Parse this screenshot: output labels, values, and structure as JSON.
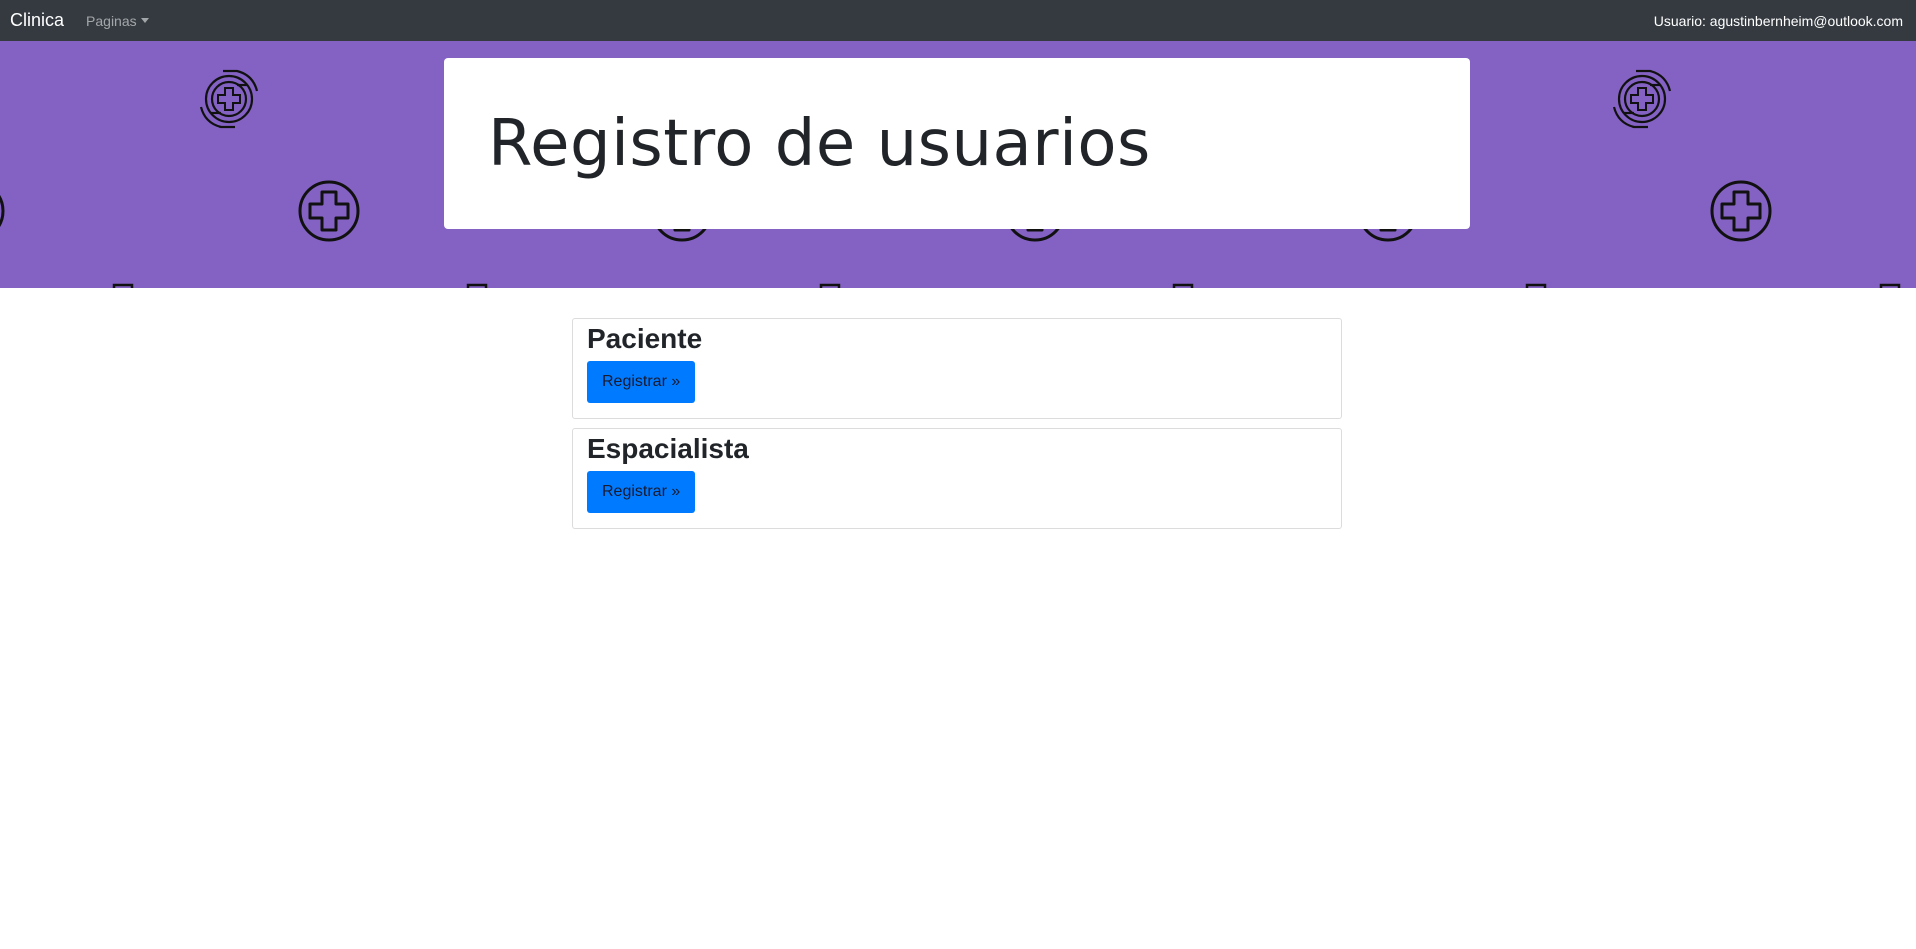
{
  "navbar": {
    "brand": "Clinica",
    "dropdown_label": "Paginas",
    "user_text": "Usuario: agustinbernheim@outlook.com"
  },
  "hero": {
    "title": "Registro de usuarios"
  },
  "cards": [
    {
      "title": "Paciente",
      "button_label": "Registrar »"
    },
    {
      "title": "Espacialista",
      "button_label": "Registrar »"
    }
  ],
  "colors": {
    "navbar_bg": "#343a40",
    "hero_bg": "#8462c4",
    "button_bg": "#007bff"
  },
  "icons": [
    "medical-cross-icon",
    "caring-hands-cross-icon",
    "caret-down-icon"
  ]
}
